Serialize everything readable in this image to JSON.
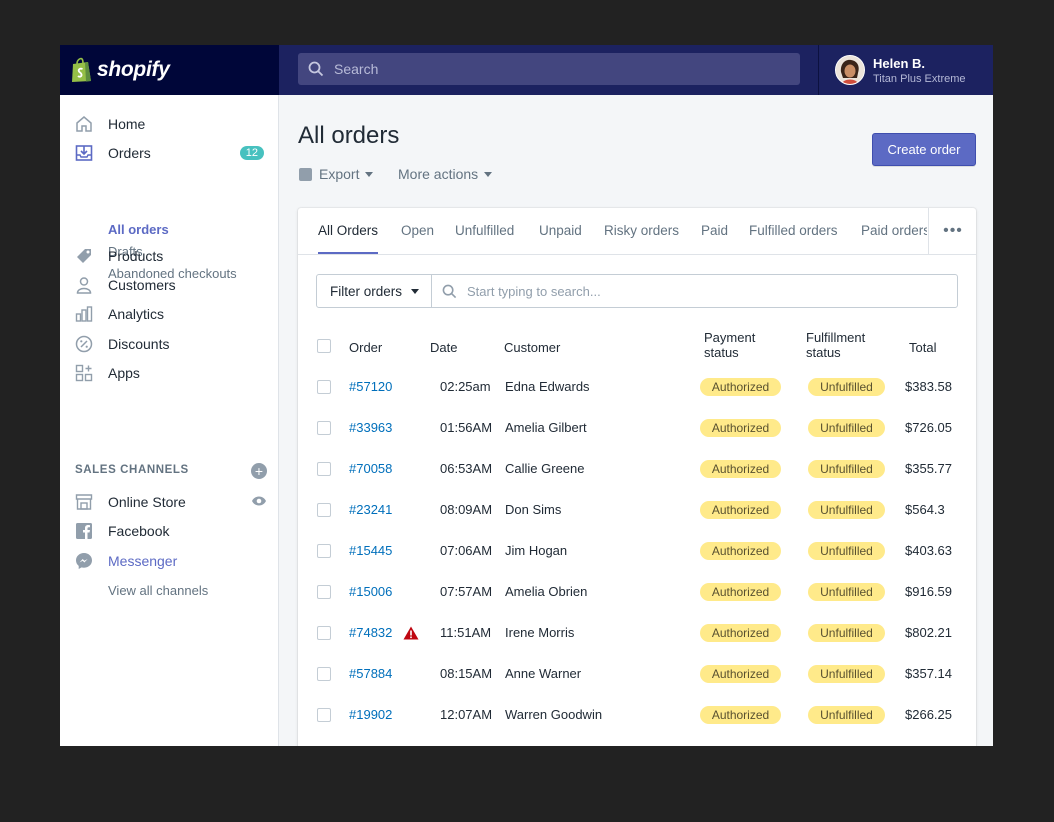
{
  "brand": {
    "name": "shopify"
  },
  "search": {
    "placeholder": "Search"
  },
  "user": {
    "name": "Helen B.",
    "store": "Titan Plus Extreme"
  },
  "sidebar": {
    "home": "Home",
    "orders": {
      "label": "Orders",
      "count": "12"
    },
    "orders_sub": [
      "All orders",
      "Drafts",
      "Abandoned checkouts"
    ],
    "products": "Products",
    "customers": "Customers",
    "analytics": "Analytics",
    "discounts": "Discounts",
    "apps": "Apps",
    "sales_channels_heading": "SALES CHANNELS",
    "channels": [
      "Online Store",
      "Facebook",
      "Messenger"
    ],
    "view_all": "View all channels"
  },
  "page": {
    "title": "All orders",
    "export_label": "Export",
    "more_actions_label": "More actions",
    "create_button": "Create order"
  },
  "tabs": [
    "All Orders",
    "Open",
    "Unfulfilled",
    "Unpaid",
    "Risky orders",
    "Paid",
    "Fulfilled orders",
    "Paid orders"
  ],
  "filter": {
    "button_label": "Filter orders",
    "placeholder": "Start typing to search..."
  },
  "table": {
    "headers": {
      "order": "Order",
      "date": "Date",
      "customer": "Customer",
      "payment_line1": "Payment",
      "payment_line2": "status",
      "fulfillment_line1": "Fulfillment",
      "fulfillment_line2": "status",
      "total": "Total"
    },
    "rows": [
      {
        "order": "#57120",
        "date": "02:25am",
        "customer": "Edna Edwards",
        "payment": "Authorized",
        "fulfillment": "Unfulfilled",
        "total": "$383.58",
        "flag": false
      },
      {
        "order": "#33963",
        "date": "01:56AM",
        "customer": "Amelia Gilbert",
        "payment": "Authorized",
        "fulfillment": "Unfulfilled",
        "total": "$726.05",
        "flag": false
      },
      {
        "order": "#70058",
        "date": "06:53AM",
        "customer": "Callie Greene",
        "payment": "Authorized",
        "fulfillment": "Unfulfilled",
        "total": "$355.77",
        "flag": false
      },
      {
        "order": "#23241",
        "date": "08:09AM",
        "customer": "Don Sims",
        "payment": "Authorized",
        "fulfillment": "Unfulfilled",
        "total": "$564.3",
        "flag": false
      },
      {
        "order": "#15445",
        "date": "07:06AM",
        "customer": "Jim Hogan",
        "payment": "Authorized",
        "fulfillment": "Unfulfilled",
        "total": "$403.63",
        "flag": false
      },
      {
        "order": "#15006",
        "date": "07:57AM",
        "customer": "Amelia Obrien",
        "payment": "Authorized",
        "fulfillment": "Unfulfilled",
        "total": "$916.59",
        "flag": false
      },
      {
        "order": "#74832",
        "date": "11:51AM",
        "customer": "Irene Morris",
        "payment": "Authorized",
        "fulfillment": "Unfulfilled",
        "total": "$802.21",
        "flag": true
      },
      {
        "order": "#57884",
        "date": "08:15AM",
        "customer": "Anne Warner",
        "payment": "Authorized",
        "fulfillment": "Unfulfilled",
        "total": "$357.14",
        "flag": false
      },
      {
        "order": "#19902",
        "date": "12:07AM",
        "customer": "Warren Goodwin",
        "payment": "Authorized",
        "fulfillment": "Unfulfilled",
        "total": "$266.25",
        "flag": false
      }
    ]
  },
  "colors": {
    "brand_dark": "#000639",
    "topbar": "#1c2260",
    "accent": "#5c6ac4",
    "link": "#006fbb",
    "badge": "#47c1bf",
    "pill": "#ffea8a",
    "warning": "#bf0711"
  }
}
